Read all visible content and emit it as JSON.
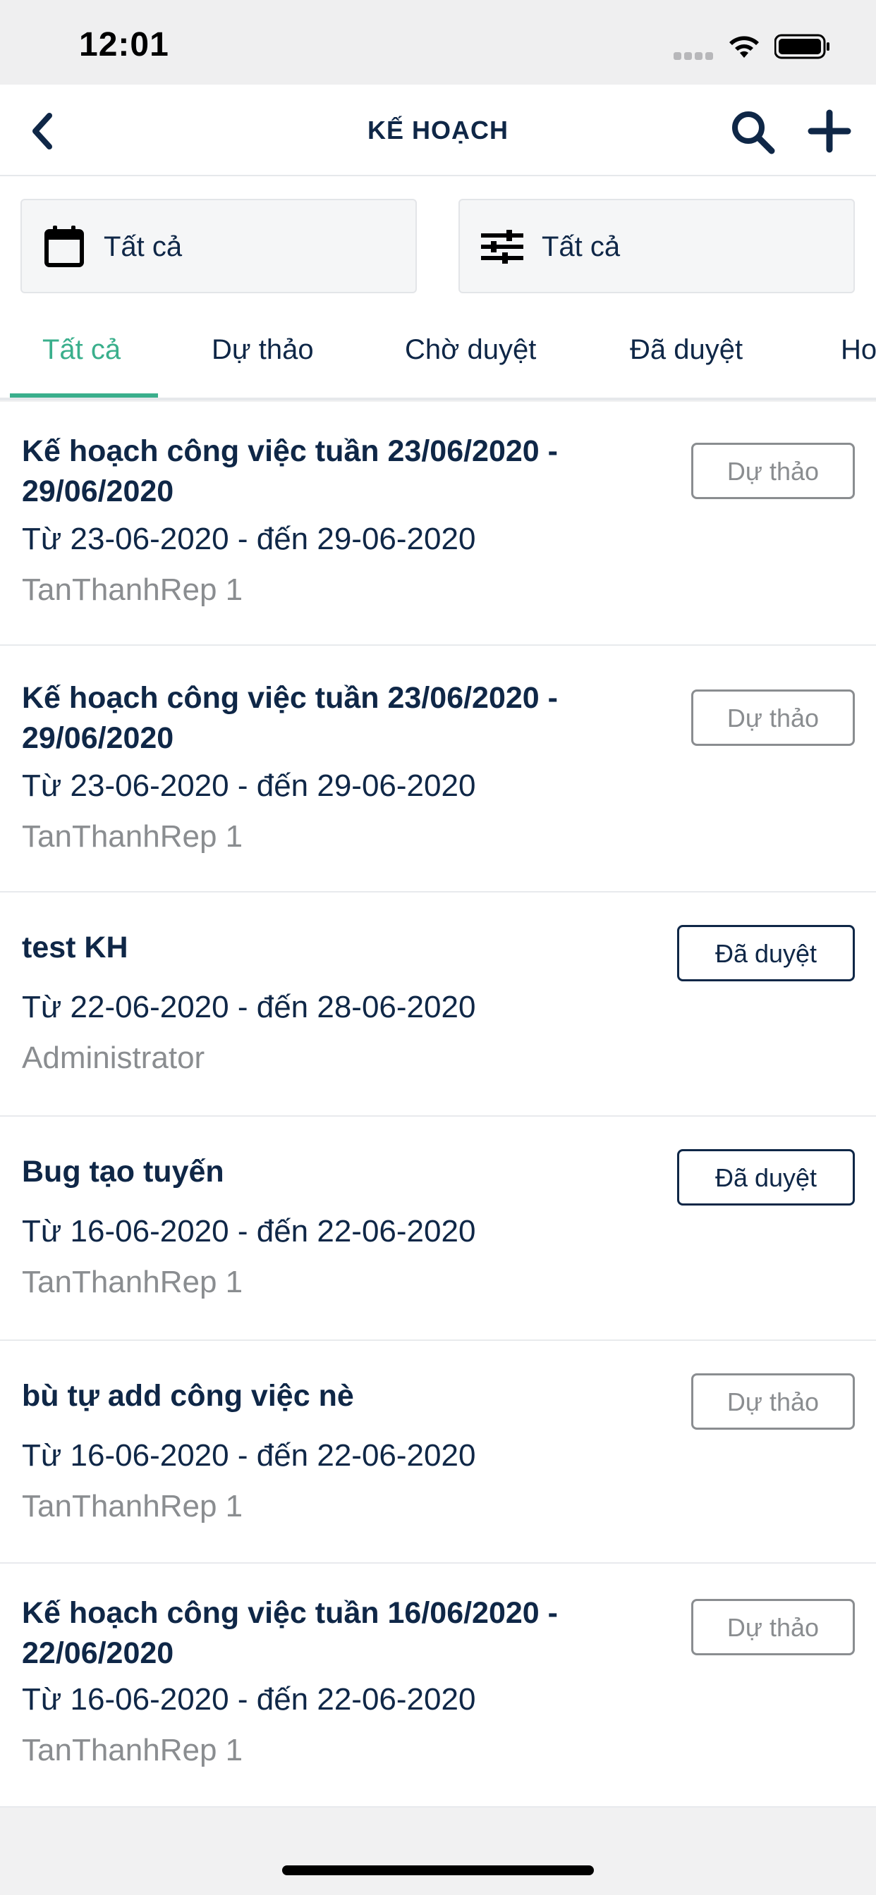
{
  "status_bar": {
    "time": "12:01"
  },
  "header": {
    "title": "KẾ HOẠCH"
  },
  "filters": {
    "date_label": "Tất cả",
    "option_label": "Tất cả"
  },
  "tabs": [
    {
      "label": "Tất cả"
    },
    {
      "label": "Dự thảo"
    },
    {
      "label": "Chờ duyệt"
    },
    {
      "label": "Đã duyệt"
    },
    {
      "label": "Ho"
    }
  ],
  "colors": {
    "accent": "#3aaf8c",
    "primary": "#0f2747",
    "muted": "#8a8d90"
  },
  "plans": [
    {
      "title": "Kế hoạch công việc tuần 23/06/2020 - 29/06/2020",
      "dates": "Từ 23-06-2020 - đến 29-06-2020",
      "author": "TanThanhRep 1",
      "status": "Dự thảo"
    },
    {
      "title": "Kế hoạch công việc tuần 23/06/2020 - 29/06/2020",
      "dates": "Từ 23-06-2020 - đến 29-06-2020",
      "author": "TanThanhRep 1",
      "status": "Dự thảo"
    },
    {
      "title": "test KH",
      "dates": "Từ 22-06-2020 - đến 28-06-2020",
      "author": "Administrator",
      "status": "Đã duyệt"
    },
    {
      "title": "Bug tạo tuyến",
      "dates": "Từ 16-06-2020 - đến 22-06-2020",
      "author": "TanThanhRep 1",
      "status": "Đã duyệt"
    },
    {
      "title": "bù tự add công việc nè",
      "dates": "Từ 16-06-2020 - đến 22-06-2020",
      "author": "TanThanhRep 1",
      "status": "Dự thảo"
    },
    {
      "title": "Kế hoạch công việc tuần 16/06/2020 - 22/06/2020",
      "dates": "Từ 16-06-2020 - đến 22-06-2020",
      "author": "TanThanhRep 1",
      "status": "Dự thảo"
    }
  ]
}
